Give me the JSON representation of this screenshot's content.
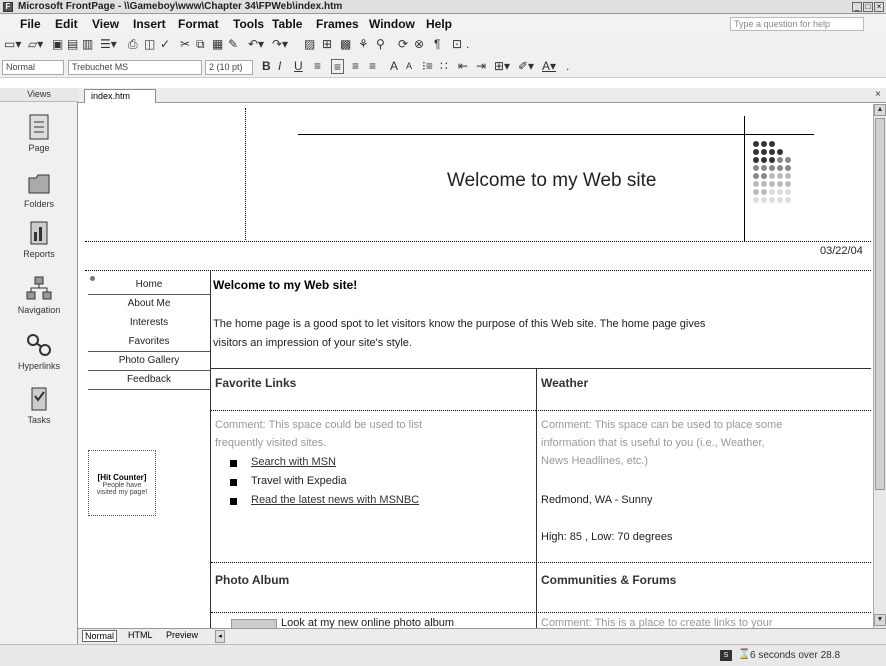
{
  "window": {
    "title": "Microsoft FrontPage - \\\\Gameboy\\www\\Chapter 34\\FPWeb\\index.htm"
  },
  "menu": [
    "File",
    "Edit",
    "View",
    "Insert",
    "Format",
    "Tools",
    "Table",
    "Frames",
    "Window",
    "Help"
  ],
  "help_placeholder": "Type a question for help",
  "format_toolbar": {
    "style": "Normal",
    "font": "Trebuchet MS",
    "size": "2 (10 pt)"
  },
  "views": {
    "header": "Views",
    "items": [
      {
        "label": "Page",
        "icon": "page-icon"
      },
      {
        "label": "Folders",
        "icon": "folders-icon"
      },
      {
        "label": "Reports",
        "icon": "reports-icon"
      },
      {
        "label": "Navigation",
        "icon": "navigation-icon"
      },
      {
        "label": "Hyperlinks",
        "icon": "hyperlinks-icon"
      },
      {
        "label": "Tasks",
        "icon": "tasks-icon"
      }
    ]
  },
  "document_tab": "index.htm",
  "page": {
    "banner_title": "Welcome to my Web site",
    "date": "03/22/04",
    "nav": [
      "Home",
      "About Me",
      "Interests",
      "Favorites",
      "Photo Gallery",
      "Feedback"
    ],
    "hit_counter": {
      "label": "[Hit Counter]",
      "text": [
        "People have",
        "visited my page!"
      ]
    },
    "heading": "Welcome to my Web site!",
    "intro": [
      "The home page is a good spot to let visitors know the purpose of this Web site. The home page gives",
      "visitors an impression of your site's style."
    ],
    "favorite_links": {
      "title": "Favorite Links",
      "comment": [
        "Comment: This space could be used to list",
        "frequently visited sites."
      ],
      "links": [
        "Search with MSN",
        "Travel with Expedia",
        "Read the latest news with MSNBC"
      ]
    },
    "weather": {
      "title": "Weather",
      "comment": [
        "Comment: This space can be used to place some",
        "information that is useful to you (i.e., Weather,",
        "News Headlines, etc.)"
      ],
      "location": "Redmond, WA - Sunny",
      "temps": "High: 85 , Low: 70 degrees"
    },
    "photo_album": {
      "title": "Photo Album",
      "text": "Look at my new online photo album"
    },
    "communities": {
      "title": "Communities & Forums",
      "comment": "Comment: This is a place to create links to your"
    }
  },
  "bottom_tabs": [
    "Normal",
    "HTML",
    "Preview"
  ],
  "status": "6 seconds over 28.8"
}
